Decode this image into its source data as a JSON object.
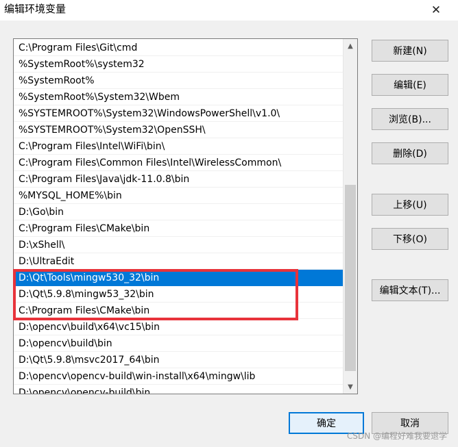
{
  "window": {
    "title": "编辑环境变量",
    "close_glyph": "✕"
  },
  "path_list": {
    "items": [
      "C:\\Program Files\\Git\\cmd",
      "%SystemRoot%\\system32",
      "%SystemRoot%",
      "%SystemRoot%\\System32\\Wbem",
      "%SYSTEMROOT%\\System32\\WindowsPowerShell\\v1.0\\",
      "%SYSTEMROOT%\\System32\\OpenSSH\\",
      "C:\\Program Files\\Intel\\WiFi\\bin\\",
      "C:\\Program Files\\Common Files\\Intel\\WirelessCommon\\",
      "C:\\Program Files\\Java\\jdk-11.0.8\\bin",
      "%MYSQL_HOME%\\bin",
      "D:\\Go\\bin",
      "C:\\Program Files\\CMake\\bin",
      "D:\\xShell\\",
      "D:\\UltraEdit",
      "D:\\Qt\\Tools\\mingw530_32\\bin",
      "D:\\Qt\\5.9.8\\mingw53_32\\bin",
      "C:\\Program Files\\CMake\\bin",
      "D:\\opencv\\build\\x64\\vc15\\bin",
      "D:\\opencv\\build\\bin",
      "D:\\Qt\\5.9.8\\msvc2017_64\\bin",
      "D:\\opencv\\opencv-build\\win-install\\x64\\mingw\\lib",
      "D:\\opencv\\opencv-build\\bin"
    ],
    "selected_index": 14,
    "selected_color": "#0078d7",
    "annotation_color": "#e8333b"
  },
  "scrollbar": {
    "up_glyph": "▲",
    "down_glyph": "▼"
  },
  "buttons": {
    "new": "新建(N)",
    "edit": "编辑(E)",
    "browse": "浏览(B)...",
    "delete": "删除(D)",
    "move_up": "上移(U)",
    "move_down": "下移(O)",
    "edit_text": "编辑文本(T)...",
    "ok": "确定",
    "cancel": "取消"
  },
  "watermark": "CSDN @编程好难我要退学"
}
